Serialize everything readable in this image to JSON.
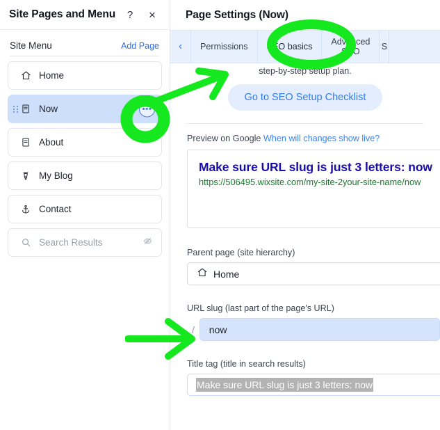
{
  "left_panel": {
    "title": "Site Pages and Menu",
    "help_icon": "?",
    "close_icon": "×",
    "site_menu_label": "Site Menu",
    "add_page_label": "Add Page",
    "items": [
      {
        "label": "Home",
        "icon": "home-icon",
        "selected": false,
        "hidden": false
      },
      {
        "label": "Now",
        "icon": "page-icon",
        "selected": true,
        "hidden": false
      },
      {
        "label": "About",
        "icon": "page-icon",
        "selected": false,
        "hidden": false
      },
      {
        "label": "My Blog",
        "icon": "pen-icon",
        "selected": false,
        "hidden": false
      },
      {
        "label": "Contact",
        "icon": "anchor-icon",
        "selected": false,
        "hidden": false
      },
      {
        "label": "Search Results",
        "icon": "search-icon",
        "selected": false,
        "hidden": true
      }
    ],
    "more_options_label": "•••"
  },
  "right_panel": {
    "title": "Page Settings (Now)",
    "tab_back_icon": "‹",
    "tabs": [
      {
        "label": "Permissions",
        "active": false,
        "partial": false
      },
      {
        "label": "SEO basics",
        "active": true,
        "partial": false
      },
      {
        "label": "Advanced\nSEO",
        "active": false,
        "partial": false
      },
      {
        "label": "S",
        "active": false,
        "partial": true
      }
    ],
    "sub_note": "step-by-step setup plan.",
    "checklist_button": "Go to SEO Setup Checklist",
    "preview": {
      "label": "Preview on Google",
      "link": "When will changes show live?",
      "title": "Make sure URL slug is just 3 letters: now",
      "url": "https://506495.wixsite.com/my-site-2your-site-name/now"
    },
    "parent_page": {
      "label": "Parent page (site hierarchy)",
      "value": "Home",
      "icon": "home-icon"
    },
    "url_slug": {
      "label": "URL slug (last part of the page's URL)",
      "prefix": "/",
      "value": "now",
      "placeholder": "now"
    },
    "title_tag": {
      "label": "Title tag (title in search results)",
      "value": "Make sure URL slug is just 3 letters: now"
    }
  },
  "annotations": {
    "color": "#16e820",
    "circle_dots_button": "circle highlighting the page more-options button",
    "arrow_to_dots_button": "arrow pointing to the more-options button",
    "circle_seo_tab": "circle highlighting the SEO basics tab",
    "arrow_to_url_slug": "arrow pointing to the URL slug field"
  },
  "colors": {
    "accent_blue": "#2b6fe8",
    "selected_row": "#cddffb",
    "tabbar_bg": "#e8f0fd",
    "google_title": "#1a0dab",
    "google_url": "#1a7a2e",
    "annotation_green": "#16e820",
    "selection_gray": "#b3b3b3"
  }
}
